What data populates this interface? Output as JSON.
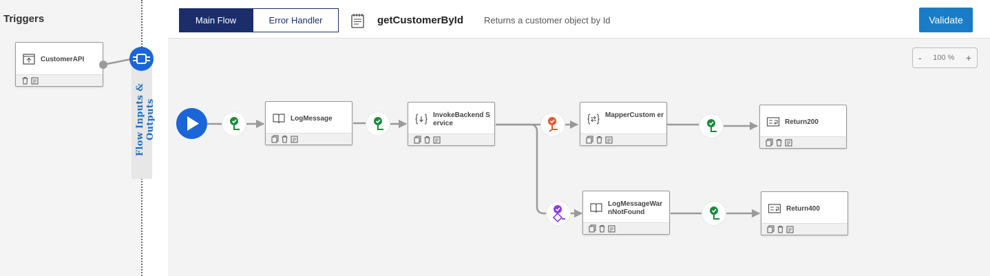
{
  "triggers": {
    "title": "Triggers",
    "items": [
      {
        "label": "CustomerAPI"
      }
    ]
  },
  "flow_io_label": "Flow Inputs & Outputs",
  "tabs": [
    {
      "label": "Main Flow",
      "active": true
    },
    {
      "label": "Error Handler",
      "active": false
    }
  ],
  "flow": {
    "name": "getCustomerById",
    "description": "Returns a customer object by Id"
  },
  "validate_label": "Validate",
  "zoom": {
    "minus": "-",
    "level": "100 %",
    "plus": "+"
  },
  "steps": {
    "log_message": "LogMessage",
    "invoke_backend": "InvokeBackend Service",
    "mapper_customer": "MapperCustom er",
    "return200": "Return200",
    "log_warn": "LogMessageWar nNotFound",
    "return400": "Return400"
  },
  "colors": {
    "accent": "#1a66d8",
    "tab_active": "#1b2e6b",
    "validate": "#1a7cc6",
    "condition_success": "#1a8a3c",
    "condition_error": "#e8572b",
    "condition_otherwise": "#8a3ee8"
  },
  "icons": {
    "start": "play-icon",
    "condition": "branch-condition-icon",
    "copy": "copy-icon",
    "delete": "trash-icon",
    "notes": "notes-icon"
  }
}
